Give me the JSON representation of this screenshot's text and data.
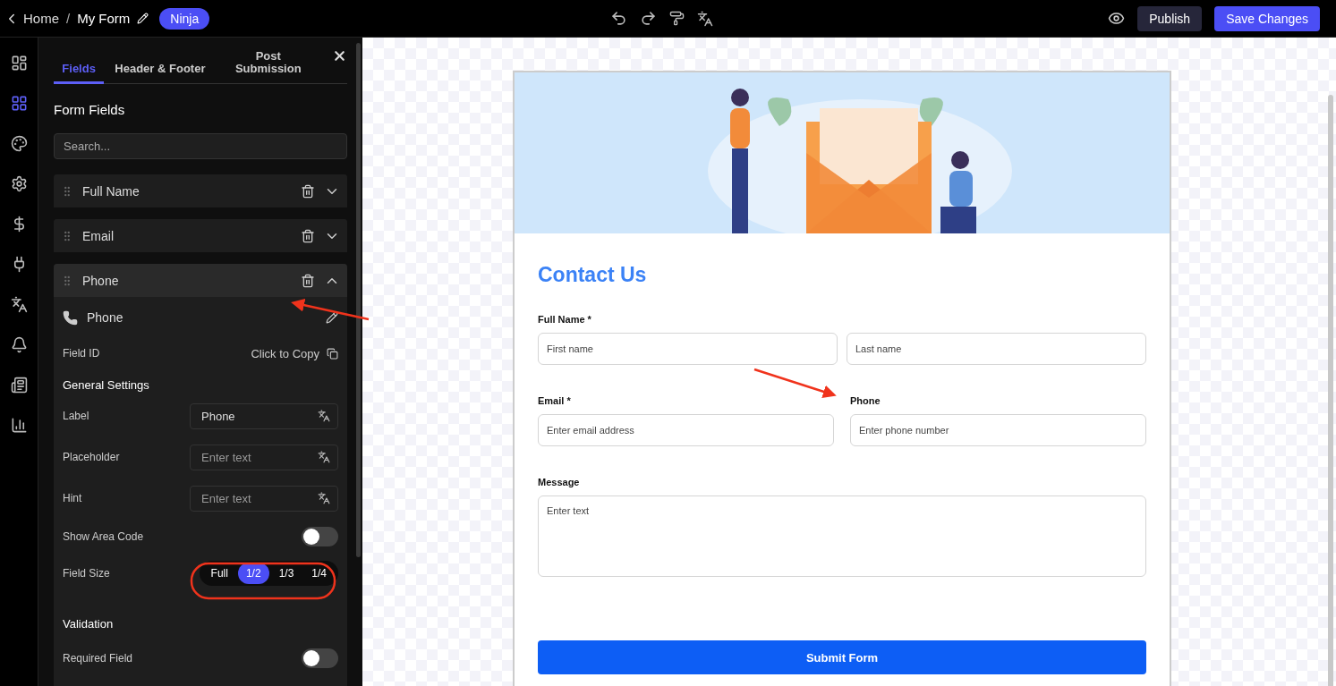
{
  "topbar": {
    "back": "Home",
    "separator": "/",
    "title": "My Form",
    "badge": "Ninja",
    "publish": "Publish",
    "save": "Save Changes"
  },
  "rail": [
    {
      "selected": false
    },
    {
      "selected": true
    },
    {
      "selected": false
    },
    {
      "selected": false
    },
    {
      "selected": false
    },
    {
      "selected": false
    },
    {
      "selected": false
    },
    {
      "selected": false
    },
    {
      "selected": false
    },
    {
      "selected": false
    }
  ],
  "panel": {
    "tabs": [
      {
        "label": "Fields",
        "selected": true
      },
      {
        "label": "Header & Footer",
        "selected": false
      },
      {
        "label": "Post Submission",
        "selected": false
      }
    ],
    "heading": "Form Fields",
    "search": {
      "placeholder": "Search..."
    },
    "fields": [
      {
        "label": "Full Name",
        "expanded": false
      },
      {
        "label": "Email",
        "expanded": false
      },
      {
        "label": "Phone",
        "expanded": true
      }
    ],
    "details": {
      "type_label": "Phone",
      "field_id_label": "Field ID",
      "copy": "Click to Copy",
      "general": "General Settings",
      "inputs": [
        {
          "label": "Label",
          "value": "Phone"
        },
        {
          "label": "Placeholder",
          "placeholder": "Enter text"
        },
        {
          "label": "Hint",
          "placeholder": "Enter text"
        }
      ],
      "area_code": {
        "label": "Show Area Code",
        "on": false
      },
      "size": {
        "label": "Field Size",
        "options": [
          {
            "label": "Full",
            "selected": false
          },
          {
            "label": "1/2",
            "selected": true
          },
          {
            "label": "1/3",
            "selected": false
          },
          {
            "label": "1/4",
            "selected": false
          }
        ]
      },
      "validation": "Validation",
      "required": {
        "label": "Required Field",
        "on": false
      }
    }
  },
  "form": {
    "title": "Contact Us",
    "rows": [
      {
        "label": "Full Name *",
        "fields": [
          {
            "placeholder": "First name"
          },
          {
            "placeholder": "Last name"
          }
        ]
      },
      {
        "label": "Email *",
        "fields": [
          {
            "placeholder": "Enter email address"
          }
        ]
      },
      {
        "label": "Phone",
        "fields": [
          {
            "placeholder": "Enter phone number"
          }
        ]
      }
    ],
    "message": {
      "label": "Message",
      "placeholder": "Enter text"
    },
    "submit": "Submit Form"
  }
}
